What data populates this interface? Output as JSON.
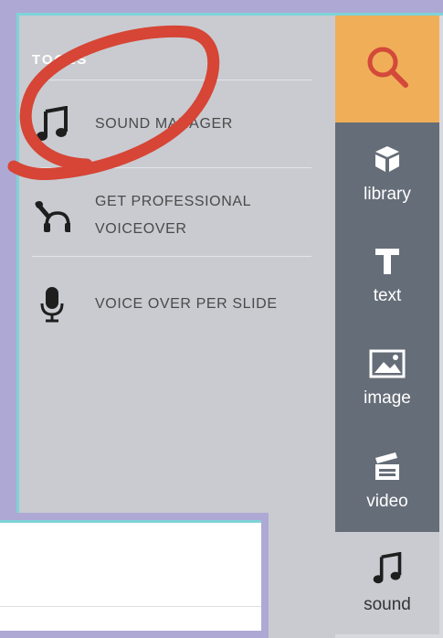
{
  "panel": {
    "title": "TOOLS",
    "items": [
      {
        "label": "SOUND MANAGER",
        "icon": "music-note-icon"
      },
      {
        "label": "GET PROFESSIONAL VOICEOVER",
        "icon": "voiceover-icon"
      },
      {
        "label": "VOICE OVER PER SLIDE",
        "icon": "microphone-icon"
      }
    ]
  },
  "sidebar": {
    "search_icon": "search-icon",
    "tabs": [
      {
        "label": "library",
        "icon": "cube-icon"
      },
      {
        "label": "text",
        "icon": "text-t-icon"
      },
      {
        "label": "image",
        "icon": "image-icon"
      },
      {
        "label": "video",
        "icon": "clapperboard-icon"
      },
      {
        "label": "sound",
        "icon": "music-note-icon",
        "active": true
      }
    ]
  },
  "colors": {
    "search_bg": "#f0ae58",
    "tab_bg": "#656d78",
    "panel_bg": "#c9cbd1",
    "annotation": "#d64535"
  }
}
